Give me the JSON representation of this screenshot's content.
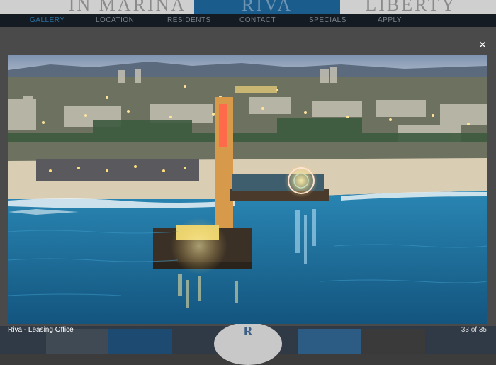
{
  "site": {
    "brand_left": "IN MARINA",
    "brand_center": "RIVA",
    "brand_right": "LIBERTY",
    "nav": [
      {
        "label": "GALLERY",
        "active": true
      },
      {
        "label": "LOCATION",
        "active": false
      },
      {
        "label": "RESIDENTS",
        "active": false
      },
      {
        "label": "CONTACT",
        "active": false
      },
      {
        "label": "SPECIALS",
        "active": false
      },
      {
        "label": "APPLY",
        "active": false
      }
    ],
    "emblem_letter": "R"
  },
  "lightbox": {
    "close_icon": "close-icon",
    "close_glyph": "×",
    "caption": "Riva - Leasing Office",
    "counter": "33 of 35",
    "photo_subject": "aerial-pier-night-photo"
  },
  "colors": {
    "nav_bg": "#151b22",
    "nav_active": "#2a6f9e",
    "brand_center_bg": "#1a5d8d",
    "ocean": "#1f6f9d",
    "sky": "#aab8cc"
  }
}
